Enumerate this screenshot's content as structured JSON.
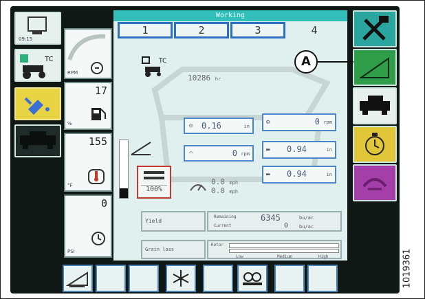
{
  "window": {
    "title": "Working"
  },
  "tabs": [
    {
      "label": "1"
    },
    {
      "label": "2"
    },
    {
      "label": "3"
    },
    {
      "label": "4",
      "active": true
    }
  ],
  "left_column": [
    {
      "icon": "monitor-icon",
      "caption": "09:15"
    },
    {
      "icon": "tractor-tc-icon",
      "caption": "TC"
    },
    {
      "icon": "satellite-icon"
    },
    {
      "icon": "header-icon"
    }
  ],
  "gauges": [
    {
      "icon": "rpm-dial-icon",
      "value": "",
      "unit": "RPM"
    },
    {
      "icon": "fuel-icon",
      "value": "17",
      "unit": "%"
    },
    {
      "icon": "temperature-icon",
      "value": "155",
      "unit": "°F"
    },
    {
      "icon": "pressure-icon",
      "value": "0",
      "unit": "PSI"
    }
  ],
  "main": {
    "tc_label": "TC",
    "engine_hours": "10286",
    "engine_hours_unit": "hr",
    "reel_value": "0.16",
    "reel_unit": "in",
    "belt_value": "0",
    "belt_unit": "rpm",
    "speed_value1": "0.0",
    "speed_unit1": "mph",
    "speed_value2": "0.0",
    "speed_unit2": "mph",
    "header_percent": "100%",
    "right_rpm_value": "0",
    "right_rpm_unit": "rpm",
    "tilt_value1": "0.94",
    "tilt_unit1": "in",
    "tilt_value2": "0.94",
    "tilt_unit2": "in",
    "yield_label": "Yield",
    "area_label_1": "Remaining",
    "area_value_1": "6345",
    "area_unit_1": "bu/ac",
    "area_label_2": "Current",
    "area_value_2": "0",
    "area_unit_2": "bu/ac",
    "grain_loss_label": "Grain loss",
    "rotor_label": "Rotor",
    "loss_low": "Low",
    "loss_medium": "Medium",
    "loss_high": "High"
  },
  "right_column": [
    {
      "icon": "tools-icon",
      "color": "#2aa59f"
    },
    {
      "icon": "header-tilt-icon",
      "color": "#2f9d4a"
    },
    {
      "icon": "combine-icon",
      "color": "#e8f0ee"
    },
    {
      "icon": "engine-icon",
      "color": "#e2c63a"
    },
    {
      "icon": "grain-loss-icon",
      "color": "#a43ea8"
    }
  ],
  "bottom_bar": [
    {
      "icon": "header-float-icon"
    },
    {
      "icon": ""
    },
    {
      "icon": ""
    },
    {
      "icon": "snowflake-icon"
    },
    {
      "icon": ""
    },
    {
      "icon": "camera-icon"
    },
    {
      "icon": ""
    }
  ],
  "callout": {
    "label": "A"
  },
  "figure_id": "1019361",
  "colors": {
    "accent": "#33bfb9",
    "tab_border": "#2f6fc2",
    "highlight_green": "#2f9d4a",
    "warning_yellow": "#e8d342"
  }
}
